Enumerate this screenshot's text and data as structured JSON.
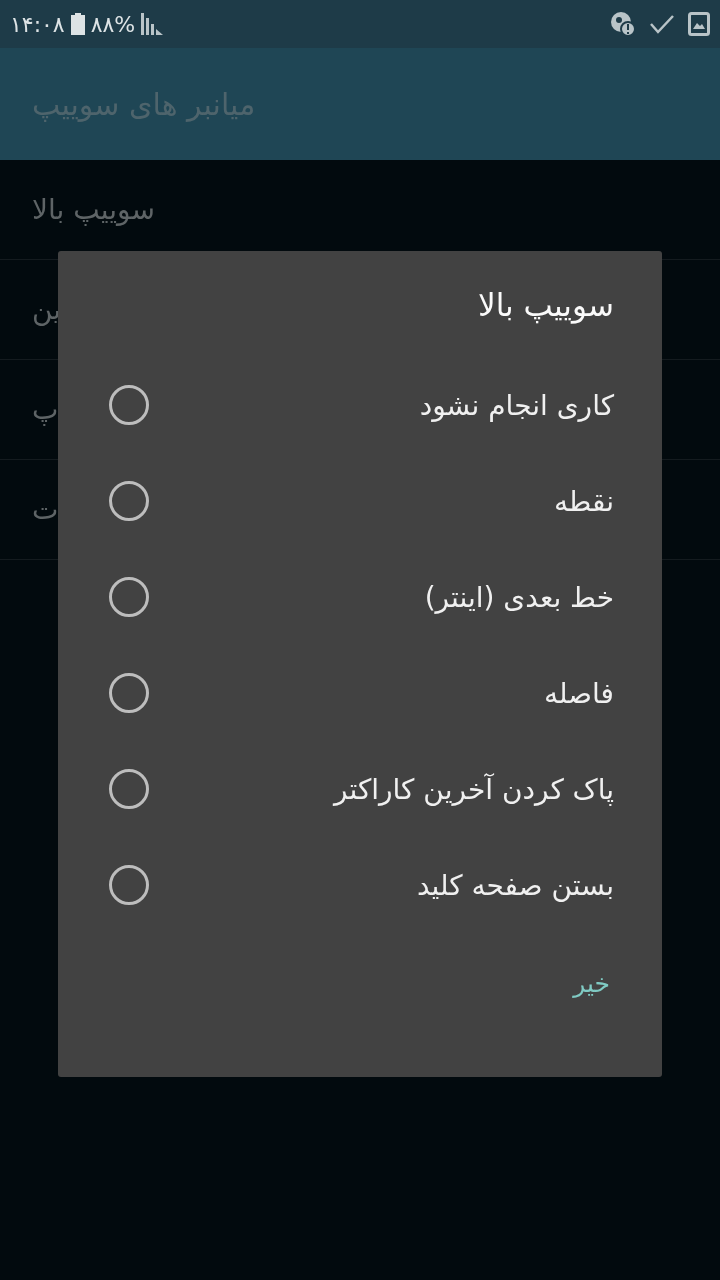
{
  "status_bar": {
    "time": "۱۴:۰۸",
    "battery": "۸۸%"
  },
  "app_bar": {
    "title": "میانبر های سوییپ"
  },
  "list": [
    {
      "label": "سوییپ بالا"
    },
    {
      "label": "ین"
    },
    {
      "label": "پ"
    },
    {
      "label": "ت"
    }
  ],
  "dialog": {
    "title": "سوییپ بالا",
    "options": [
      {
        "label": "کاری انجام نشود",
        "selected": false
      },
      {
        "label": "نقطه",
        "selected": false
      },
      {
        "label": "خط بعدی (اینتر)",
        "selected": false
      },
      {
        "label": "فاصله",
        "selected": false
      },
      {
        "label": "پاک کردن آخرین کاراکتر",
        "selected": false
      },
      {
        "label": "بستن صفحه کلید",
        "selected": false
      }
    ],
    "button": "خیر"
  }
}
